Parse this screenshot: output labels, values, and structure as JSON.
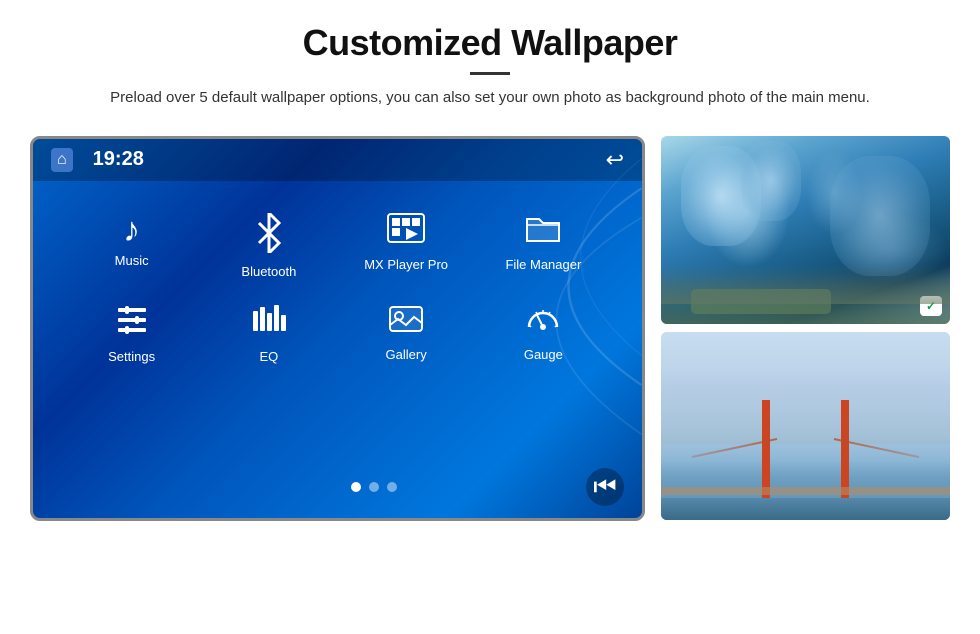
{
  "page": {
    "title": "Customized Wallpaper",
    "subtitle": "Preload over 5 default wallpaper options, you can also set your own photo as background photo of the main menu."
  },
  "device": {
    "time": "19:28",
    "apps": [
      {
        "id": "music",
        "label": "Music",
        "icon": "♪"
      },
      {
        "id": "bluetooth",
        "label": "Bluetooth",
        "icon": "⌘"
      },
      {
        "id": "mxplayer",
        "label": "MX Player Pro",
        "icon": "▦"
      },
      {
        "id": "filemanager",
        "label": "File Manager",
        "icon": "🗂"
      },
      {
        "id": "settings",
        "label": "Settings",
        "icon": "⚙"
      },
      {
        "id": "eq",
        "label": "EQ",
        "icon": "≋"
      },
      {
        "id": "gallery",
        "label": "Gallery",
        "icon": "🖼"
      },
      {
        "id": "gauge",
        "label": "Gauge",
        "icon": "◎"
      }
    ],
    "dots": [
      "active",
      "inactive",
      "inactive"
    ]
  },
  "sidebar": {
    "top_image_alt": "Ice cave wallpaper",
    "bottom_image_alt": "Golden Gate Bridge wallpaper",
    "checkmark": "✓"
  }
}
